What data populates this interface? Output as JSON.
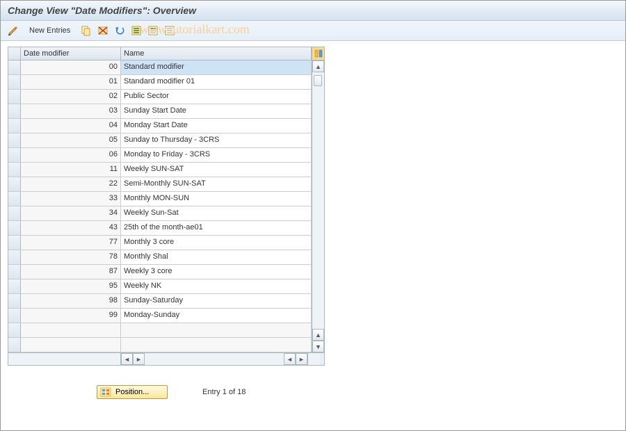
{
  "title": "Change View \"Date Modifiers\": Overview",
  "watermark": "www.tutorialkart.com",
  "toolbar": {
    "new_entries": "New Entries"
  },
  "columns": {
    "modifier": "Date modifier",
    "name": "Name"
  },
  "rows": [
    {
      "mod": "00",
      "name": "Standard modifier"
    },
    {
      "mod": "01",
      "name": "Standard modifier 01"
    },
    {
      "mod": "02",
      "name": "Public Sector"
    },
    {
      "mod": "03",
      "name": "Sunday Start Date"
    },
    {
      "mod": "04",
      "name": "Monday Start Date"
    },
    {
      "mod": "05",
      "name": "Sunday to Thursday - 3CRS"
    },
    {
      "mod": "06",
      "name": "Monday to Friday - 3CRS"
    },
    {
      "mod": "11",
      "name": "Weekly SUN-SAT"
    },
    {
      "mod": "22",
      "name": "Semi-Monthly SUN-SAT"
    },
    {
      "mod": "33",
      "name": "Monthly MON-SUN"
    },
    {
      "mod": "34",
      "name": "Weekly Sun-Sat"
    },
    {
      "mod": "43",
      "name": "25th of the month-ae01"
    },
    {
      "mod": "77",
      "name": "Monthly 3 core"
    },
    {
      "mod": "78",
      "name": "Monthly Shal"
    },
    {
      "mod": "87",
      "name": "Weekly 3 core"
    },
    {
      "mod": "95",
      "name": "Weekly NK"
    },
    {
      "mod": "98",
      "name": "Sunday-Saturday"
    },
    {
      "mod": "99",
      "name": "Monday-Sunday"
    }
  ],
  "footer": {
    "position": "Position...",
    "entry": "Entry 1 of 18"
  }
}
